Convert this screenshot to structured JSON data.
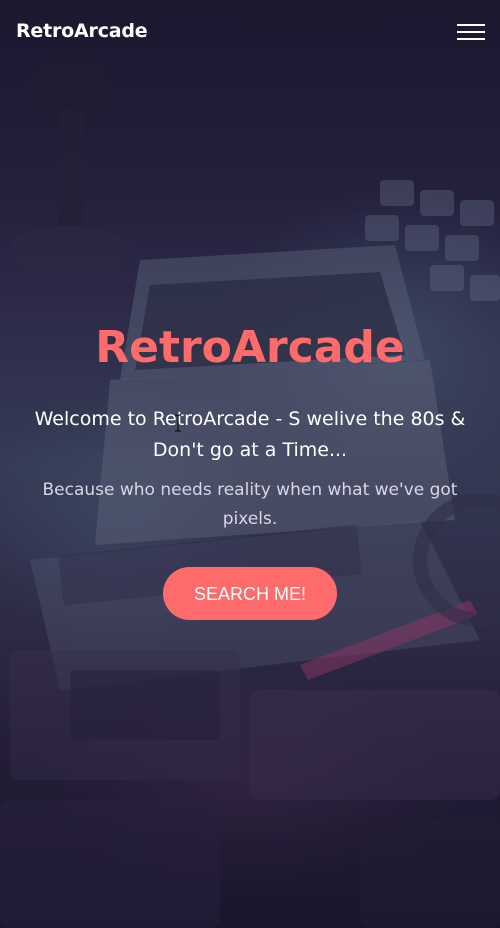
{
  "header": {
    "brand": "RetroArcade",
    "menu_icon": "hamburger-menu-icon"
  },
  "hero": {
    "title": "RetroArcade",
    "tagline": "Welcome to RetroArcade - S welive the 80s & Don't go at a Time...",
    "subtitle": "Because who needs reality when what we've got pixels.",
    "cta_label": "SEARCH ME!"
  },
  "colors": {
    "accent": "#ff6b6b",
    "text": "#ffffff",
    "background": "#1c1a33"
  }
}
